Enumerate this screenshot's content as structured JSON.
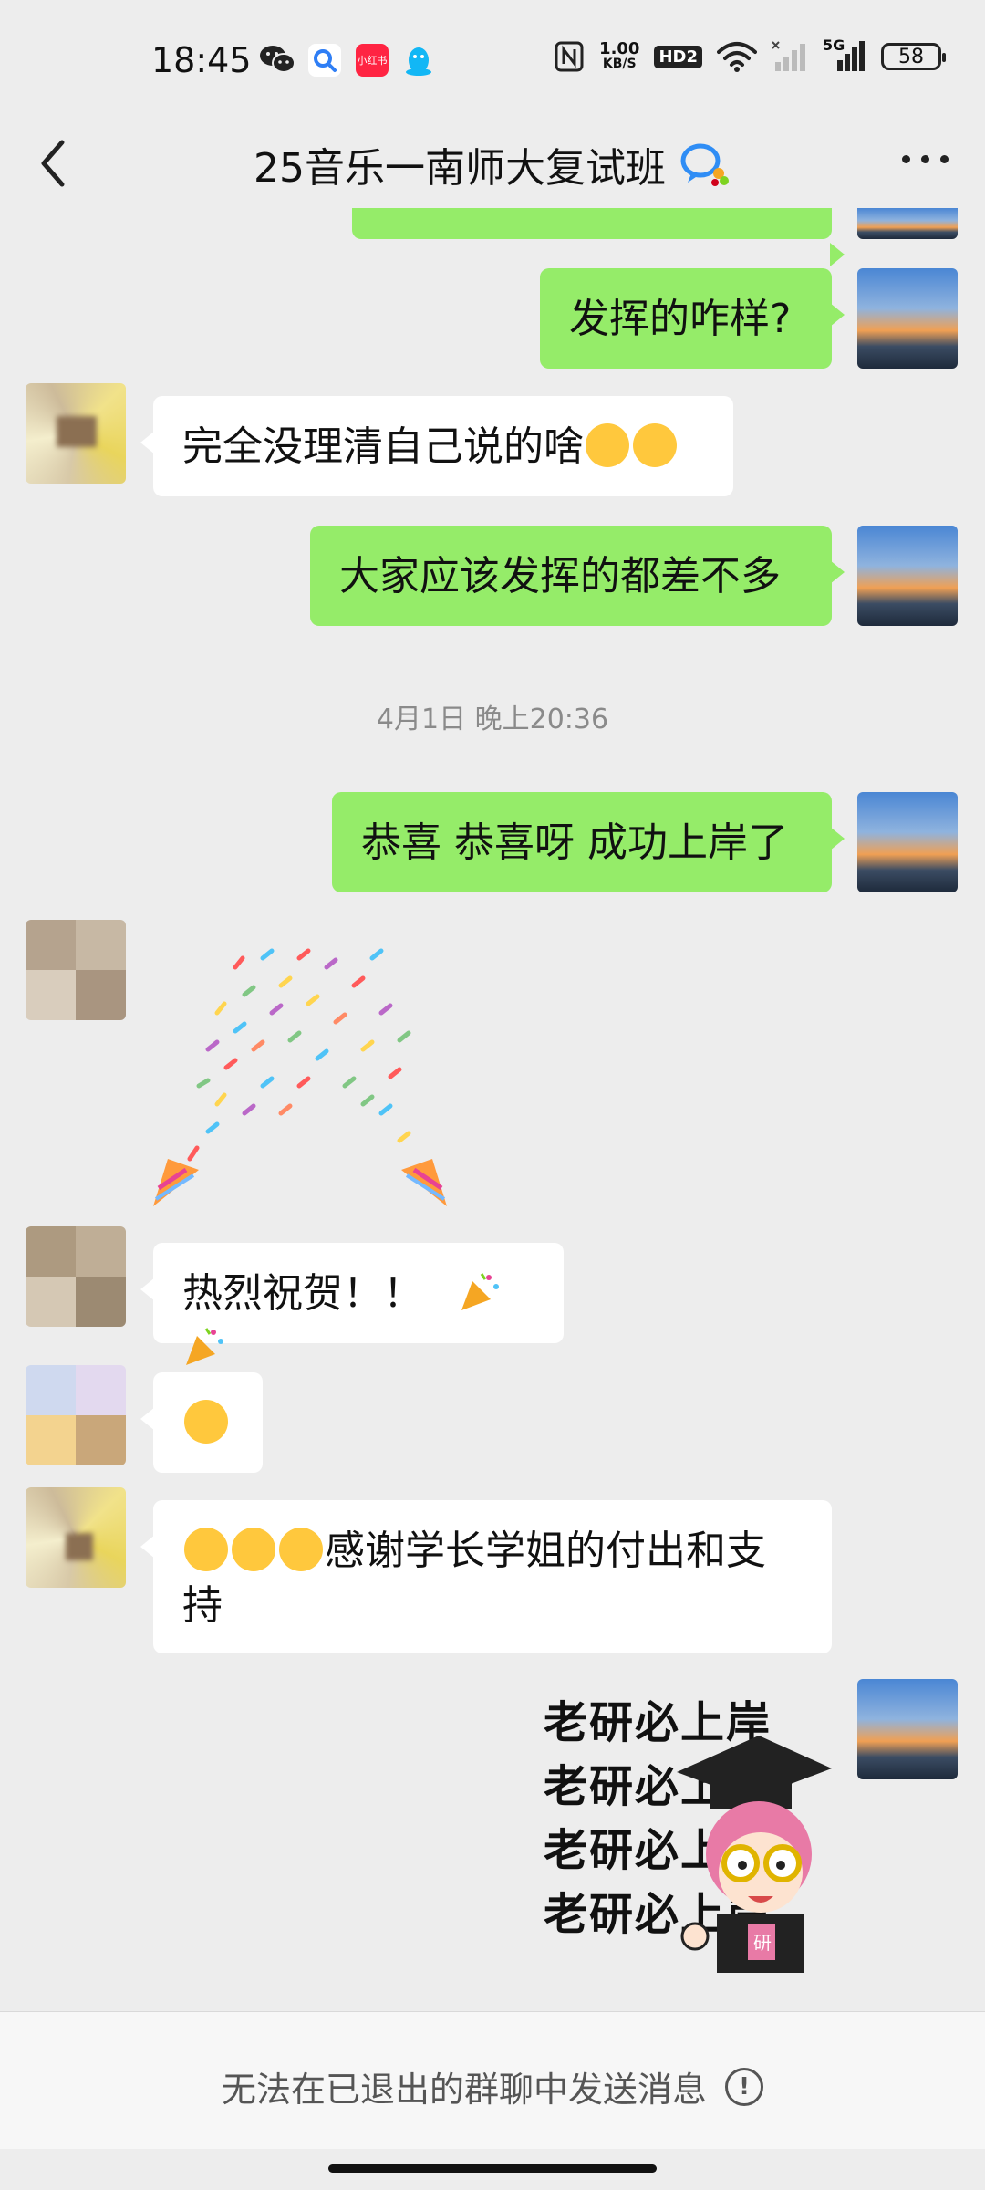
{
  "status_bar": {
    "time": "18:45",
    "net_speed": "1.00",
    "net_unit": "KB/S",
    "hd_badge": "HD2",
    "signal_label": "5G",
    "battery": "58",
    "app_badge": "小红书"
  },
  "header": {
    "title": "25音乐一南师大复试班"
  },
  "messages": {
    "m1": "发挥的咋样?",
    "m2": "完全没理清自己说的啥",
    "m3": "大家应该发挥的都差不多",
    "timestamp": "4月1日 晚上20:36",
    "m4": "恭喜 恭喜呀 成功上岸了",
    "m5": "热烈祝贺！！",
    "m7": "感谢学长学姐的付出和支持",
    "sticker_text": "老研必上岸",
    "sticker_badge": "研"
  },
  "bottom_bar": {
    "notice": "无法在已退出的群聊中发送消息"
  },
  "colors": {
    "background": "#ededed",
    "my_bubble": "#95ec69",
    "other_bubble": "#ffffff"
  }
}
